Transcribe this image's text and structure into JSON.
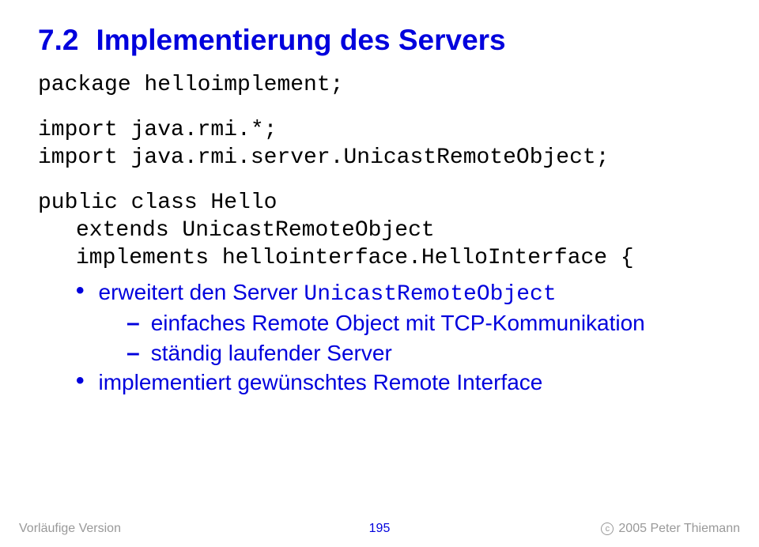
{
  "heading": {
    "number": "7.2",
    "title": "Implementierung des Servers"
  },
  "code": {
    "line1": "package helloimplement;",
    "line2": "import java.rmi.*;",
    "line3": "import java.rmi.server.UnicastRemoteObject;",
    "line4": "public class Hello",
    "line5": "extends UnicastRemoteObject",
    "line6": "implements hellointerface.HelloInterface {"
  },
  "bullets": {
    "b1_prefix": "erweitert den Server ",
    "b1_code": "UnicastRemoteObject",
    "b1_sub1": "einfaches Remote Object mit TCP-Kommunikation",
    "b1_sub2": "ständig laufender Server",
    "b2": "implementiert gewünschtes Remote Interface"
  },
  "footer": {
    "left": "Vorläufige Version",
    "center": "195",
    "right_c": "c",
    "right_text": "2005 Peter Thiemann"
  }
}
